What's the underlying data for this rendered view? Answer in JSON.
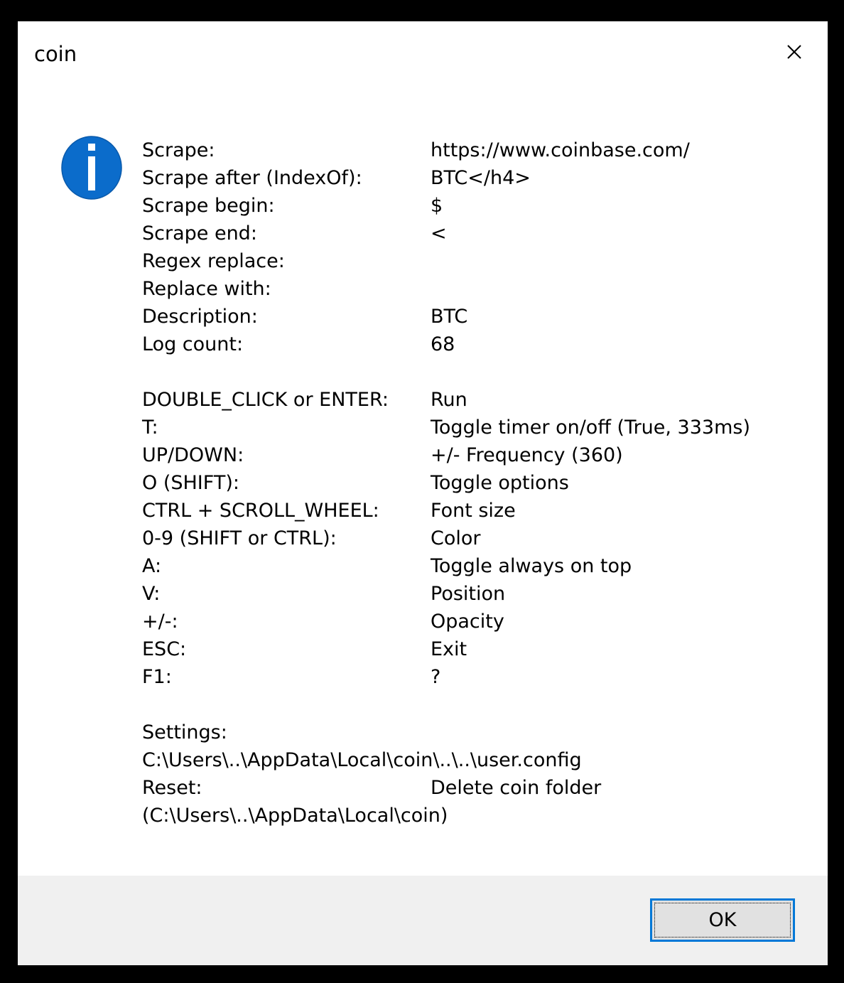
{
  "window": {
    "title": "coin"
  },
  "icons": {
    "info": "info-icon",
    "close": "close-icon"
  },
  "colors": {
    "icon_blue": "#0b6ccb",
    "button_border": "#0078d7",
    "footer_bg": "#f0f0f0"
  },
  "scrape": [
    {
      "label": "Scrape:",
      "value": "https://www.coinbase.com/"
    },
    {
      "label": "Scrape after (IndexOf):",
      "value": "BTC</h4>"
    },
    {
      "label": "Scrape begin:",
      "value": "$"
    },
    {
      "label": "Scrape end:",
      "value": "<"
    },
    {
      "label": "Regex replace:",
      "value": ""
    },
    {
      "label": "Replace with:",
      "value": ""
    },
    {
      "label": "Description:",
      "value": "BTC"
    },
    {
      "label": "Log count:",
      "value": "68"
    }
  ],
  "shortcuts": [
    {
      "key": "DOUBLE_CLICK or ENTER:",
      "action": "Run"
    },
    {
      "key": "T:",
      "action": "Toggle timer on/off (True, 333ms)"
    },
    {
      "key": "UP/DOWN:",
      "action": "+/- Frequency (360)"
    },
    {
      "key": "O (SHIFT):",
      "action": "Toggle options"
    },
    {
      "key": "CTRL + SCROLL_WHEEL:",
      "action": "Font size"
    },
    {
      "key": "0-9 (SHIFT or CTRL):",
      "action": "Color"
    },
    {
      "key": "A:",
      "action": "Toggle always on top"
    },
    {
      "key": "V:",
      "action": "Position"
    },
    {
      "key": "+/-:",
      "action": "Opacity"
    },
    {
      "key": "ESC:",
      "action": "Exit"
    },
    {
      "key": "F1:",
      "action": "?"
    }
  ],
  "settings": {
    "label": "Settings:",
    "path": "C:\\Users\\..\\AppData\\Local\\coin\\..\\..\\user.config",
    "reset_label": "Reset:",
    "reset_action": "Delete coin folder",
    "reset_path": "(C:\\Users\\..\\AppData\\Local\\coin)"
  },
  "buttons": {
    "ok": "OK"
  }
}
